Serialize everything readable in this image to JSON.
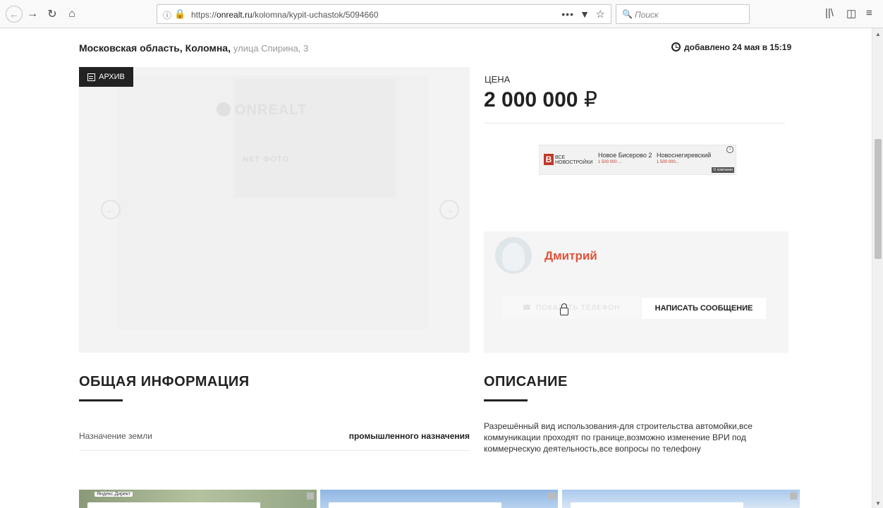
{
  "browser": {
    "url_prefix": "https://",
    "url_host": "onrealt.ru",
    "url_path": "/kolomna/kypit-uchastok/5094660",
    "url_dots": "•••",
    "search_placeholder": "Поиск"
  },
  "listing": {
    "region": "Московская область, Коломна,",
    "street": "улица Спирина, 3",
    "added": "добавлено 24 мая в 15:19",
    "archive_label": "АРХИВ",
    "placeholder_logo": "ONREALT",
    "placeholder_text": "НЕТ ФОТО",
    "price_label": "ЦЕНА",
    "price": "2 000 000",
    "currency": "₽"
  },
  "ad_banner": {
    "logo_letter": "В",
    "logo_text_1": "ВСЕ",
    "logo_text_2": "НОВОСТРОЙКИ",
    "item1_title": "Новое Бисерово 2",
    "item1_price": "1 500 000 ...",
    "item2_title": "Новоснегиревский",
    "item2_price": "1 500 000...",
    "info": "i",
    "company": "О компании"
  },
  "seller": {
    "name": "Дмитрий",
    "phone_button": "ПОКАЗАТЬ ТЕЛЕФОН",
    "message_button": "НАПИСАТЬ СООБЩЕНИЕ"
  },
  "sections": {
    "general_title": "ОБЩАЯ ИНФОРМАЦИЯ",
    "description_title": "ОПИСАНИЕ"
  },
  "general_info": [
    {
      "key": "Назначение земли",
      "value": "промышленного назначения"
    }
  ],
  "description": "Разрешённый вид использования-для строительства автомойки,все коммуникации проходят по границе,возможно изменение ВРИ под коммерческую деятельность,все вопросы по телефону",
  "direct_ads": {
    "label": "Яндекс.Директ"
  },
  "colors": {
    "accent": "#e0523a",
    "dark": "#222222",
    "lock_green": "#12bc00"
  }
}
